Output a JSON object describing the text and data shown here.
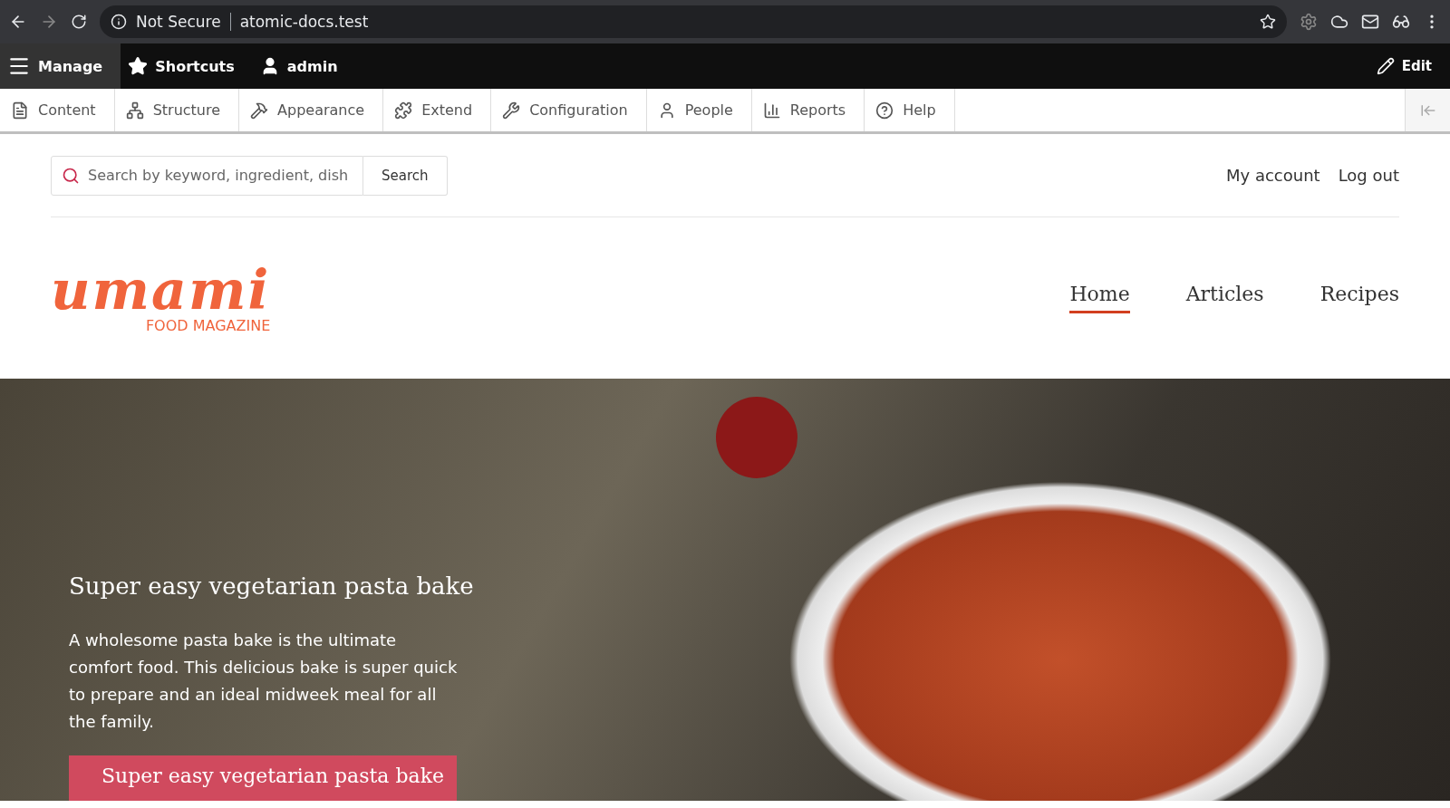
{
  "browser": {
    "security": "Not Secure",
    "url": "atomic-docs.test"
  },
  "admin_bar": {
    "items": [
      {
        "kind": "manage",
        "label": "Manage",
        "selected": true
      },
      {
        "kind": "shortcuts",
        "label": "Shortcuts",
        "selected": false
      },
      {
        "kind": "user",
        "label": "admin",
        "selected": false
      }
    ],
    "edit": "Edit"
  },
  "tray": {
    "items": [
      {
        "kind": "content",
        "label": "Content"
      },
      {
        "kind": "structure",
        "label": "Structure"
      },
      {
        "kind": "appearance",
        "label": "Appearance"
      },
      {
        "kind": "extend",
        "label": "Extend"
      },
      {
        "kind": "configuration",
        "label": "Configuration"
      },
      {
        "kind": "people",
        "label": "People"
      },
      {
        "kind": "reports",
        "label": "Reports"
      },
      {
        "kind": "help",
        "label": "Help"
      }
    ]
  },
  "search": {
    "placeholder": "Search by keyword, ingredient, dish",
    "button": "Search"
  },
  "account_links": [
    "My account",
    "Log out"
  ],
  "logo": {
    "name": "umami",
    "tagline": "FOOD MAGAZINE"
  },
  "nav": [
    {
      "label": "Home",
      "selected": true
    },
    {
      "label": "Articles",
      "selected": false
    },
    {
      "label": "Recipes",
      "selected": false
    }
  ],
  "hero": {
    "title": "Super easy vegetarian pasta bake",
    "text": "A wholesome pasta bake is the ultimate comfort food. This delicious bake is super quick to prepare and an ideal midweek meal for all the family.",
    "button": "Super easy vegetarian pasta bake"
  }
}
